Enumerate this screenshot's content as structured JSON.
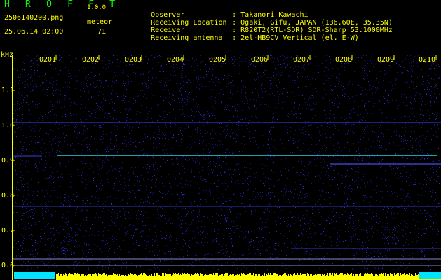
{
  "header": {
    "app_title": "H R O F F T",
    "app_version": "1.0.0",
    "file_name": "2506140200.png",
    "meteor_label": "meteor",
    "timestamp": "25.06.14 02:00",
    "meteor_count": "71",
    "info": [
      {
        "label": "Observer",
        "value": ": Takanori Kawachi"
      },
      {
        "label": "Receiving Location",
        "value": ": Ogaki, Gifu, JAPAN (136.60E, 35.35N)"
      },
      {
        "label": "Receiver",
        "value": ": R820T2(RTL-SDR) SDR-Sharp 53.1000MHz"
      },
      {
        "label": "Receiving antenna",
        "value": ": 2el-HB9CV Vertical (el. E-W)"
      }
    ]
  },
  "axis": {
    "y_unit": "kHz",
    "y_ticks": [
      "1.1",
      "1.0",
      "0.9",
      "0.8",
      "0.7",
      "0.6"
    ],
    "x_ticks": [
      "0201",
      "0202",
      "0203",
      "0204",
      "0205",
      "0206",
      "0207",
      "0208",
      "0209",
      "0210"
    ]
  },
  "colors": {
    "background": "#000000",
    "header_title": "#00ff00",
    "header_text": "#ffff00",
    "axis_text": "#ffff00",
    "noise": "#1a1a8c",
    "carrier": "#29d3e6",
    "echo_bar": "#ffff00",
    "echo_cyan": "#00e5ff"
  }
}
